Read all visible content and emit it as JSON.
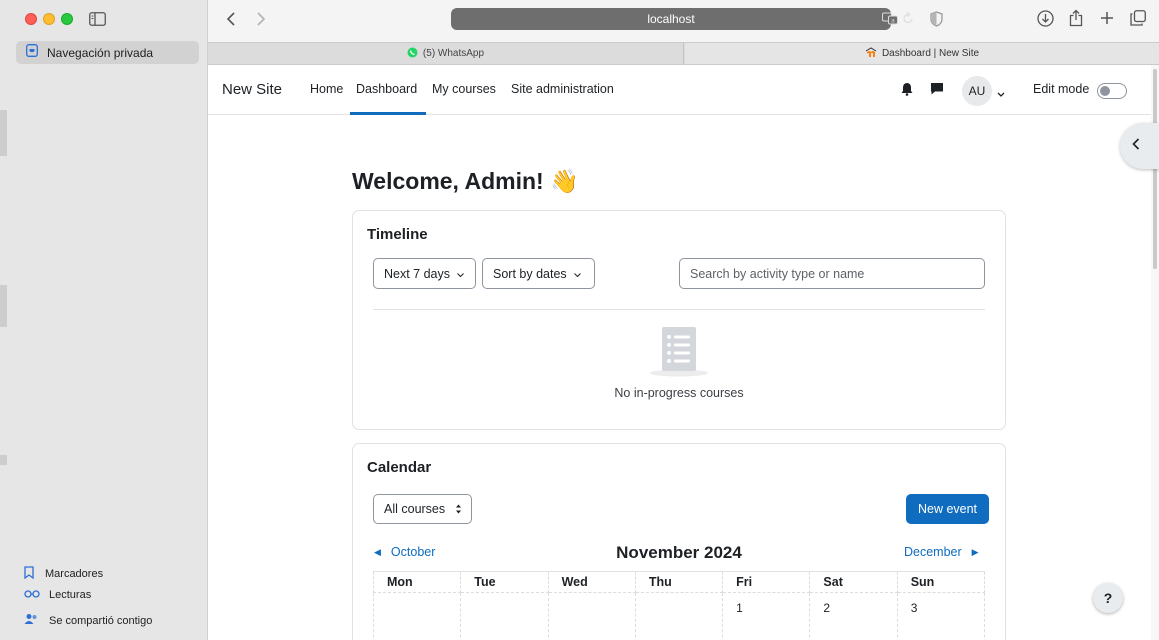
{
  "sidebar": {
    "private_browsing_label": "Navegación privada",
    "footer_items": [
      {
        "label": "Marcadores",
        "icon": "bookmark-icon"
      },
      {
        "label": "Lecturas",
        "icon": "reading-list-icon"
      },
      {
        "label": "Se compartió contigo",
        "icon": "shared-with-you-icon"
      }
    ]
  },
  "browser": {
    "url": "localhost",
    "tabs": [
      {
        "label": "(5) WhatsApp",
        "icon": "whatsapp-icon"
      },
      {
        "label": "Dashboard | New Site",
        "icon": "moodle-icon"
      }
    ]
  },
  "nav": {
    "site_name": "New Site",
    "links": [
      "Home",
      "Dashboard",
      "My courses",
      "Site administration"
    ],
    "active_link": "Dashboard",
    "avatar_initials": "AU",
    "edit_mode_label": "Edit mode",
    "edit_mode_on": false
  },
  "welcome": {
    "title": "Welcome, Admin! 👋"
  },
  "timeline": {
    "title": "Timeline",
    "filter_days": "Next 7 days",
    "sort": "Sort by dates",
    "search_placeholder": "Search by activity type or name",
    "empty_message": "No in-progress courses"
  },
  "calendar": {
    "title": "Calendar",
    "course_filter": "All courses",
    "new_event_label": "New event",
    "prev_month": "October",
    "current_month": "November 2024",
    "next_month": "December",
    "weekdays": [
      "Mon",
      "Tue",
      "Wed",
      "Thu",
      "Fri",
      "Sat",
      "Sun"
    ],
    "first_week": [
      "",
      "",
      "",
      "",
      "1",
      "2",
      "3"
    ]
  },
  "help_label": "?",
  "colors": {
    "accent": "#0f6cbf",
    "sidebar_bg": "#e6e6e6",
    "url_bar_bg": "#6e6e6e"
  }
}
